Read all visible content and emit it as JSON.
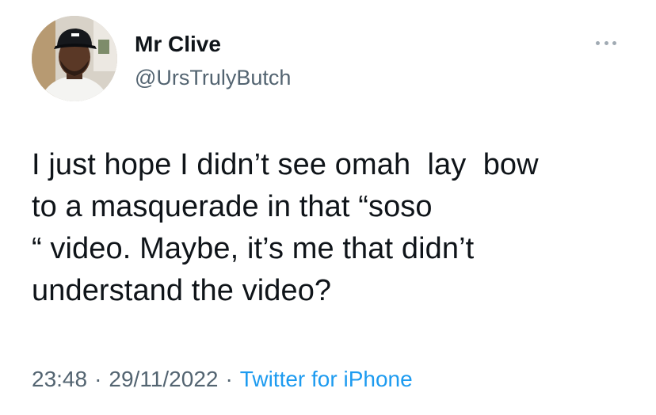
{
  "author": {
    "display_name": "Mr Clive",
    "handle": "@UrsTrulyButch"
  },
  "tweet": {
    "line1": "I just hope I didn’t see omah  lay  bow",
    "line2": "to a masquerade in that “soso",
    "line3": "“ video. Maybe, it’s me that didn’t",
    "line4": "understand the video?"
  },
  "meta": {
    "time": "23:48",
    "separator": "·",
    "date": "29/11/2022",
    "source": "Twitter for iPhone"
  },
  "icons": {
    "more": "more-options-icon"
  },
  "colors": {
    "text": "#0f1419",
    "secondary": "#536471",
    "link": "#1d9bf0",
    "background": "#ffffff"
  }
}
